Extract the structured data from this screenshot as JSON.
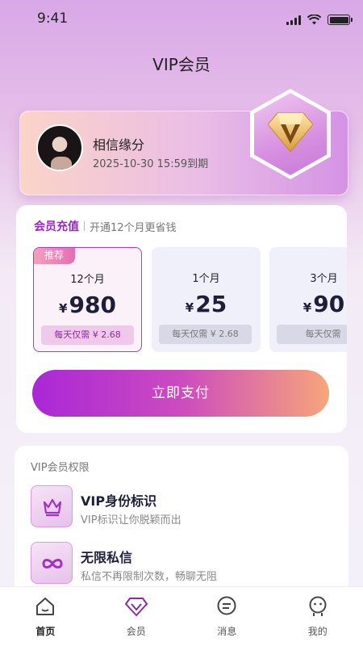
{
  "status_bar": {
    "time": "9:41"
  },
  "header": {
    "title": "VIP会员"
  },
  "profile": {
    "name": "相信缘分",
    "expire": "2025-10-30 15:59到期"
  },
  "recharge": {
    "title": "会员充值",
    "subtitle": "开通12个月更省钱",
    "plans": [
      {
        "tag": "推荐",
        "period": "12个月",
        "currency": "¥",
        "price": "980",
        "daily": "每天仅需 ¥ 2.68",
        "selected": true
      },
      {
        "tag": "",
        "period": "1个月",
        "currency": "¥",
        "price": "25",
        "daily": "每天仅需 ¥ 2.68",
        "selected": false
      },
      {
        "tag": "",
        "period": "3个月",
        "currency": "¥",
        "price": "90",
        "daily": "每天仅需",
        "selected": false
      }
    ],
    "pay_label": "立即支付"
  },
  "rights": {
    "title": "VIP会员权限",
    "items": [
      {
        "icon": "crown-icon",
        "name": "VIP身份标识",
        "desc": "VIP标识让你脱颖而出"
      },
      {
        "icon": "infinity-icon",
        "name": "无限私信",
        "desc": "私信不再限制次数，畅聊无阻"
      }
    ]
  },
  "tabs": [
    {
      "label": "首页",
      "icon": "home-icon",
      "active": true
    },
    {
      "label": "会员",
      "icon": "vip-diamond-icon",
      "active": false
    },
    {
      "label": "消息",
      "icon": "message-icon",
      "active": false
    },
    {
      "label": "我的",
      "icon": "profile-icon",
      "active": false
    }
  ],
  "colors": {
    "accent": "#a63fc6",
    "gradient_start": "#a927d6",
    "gradient_end": "#f7a67a"
  }
}
